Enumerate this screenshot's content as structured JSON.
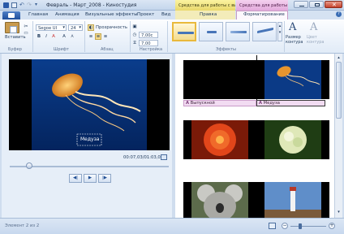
{
  "window": {
    "title": "Февраль - Март_2008 - Киностудия",
    "context_video": "Средства для работы с видео",
    "context_text": "Средства для работы с т..."
  },
  "tabs": {
    "home": "Главная",
    "animation": "Анимация",
    "visual_effects": "Визуальные эффекты",
    "project": "Проект",
    "view": "Вид",
    "edit": "Правка",
    "format": "Форматирование"
  },
  "ribbon": {
    "paste_label": "Вставить",
    "clipboard_group": "Буфер",
    "font_name": "Segoe UI",
    "font_size": "24",
    "font_group": "Шрифт",
    "transparency_label": "Прозрачность",
    "paragraph_group": "Абзац",
    "start_time": "7,00с",
    "duration": "7,00",
    "settings_group": "Настройка",
    "effects_group": "Эффекты",
    "outline_size_label": "Размер контура",
    "outline_color_label": "Цвет контура"
  },
  "preview": {
    "caption_text": "Медуза",
    "timecode": "00:07,03/01:03,00"
  },
  "storyboard": {
    "caption_1": "Выпускной",
    "caption_2": "Медуза"
  },
  "status": {
    "text": "Элемент 2 из 2"
  },
  "colors": {
    "accent": "#1f4f9c",
    "context_video": "#f3ecb9",
    "context_text": "#f4d0ef"
  }
}
